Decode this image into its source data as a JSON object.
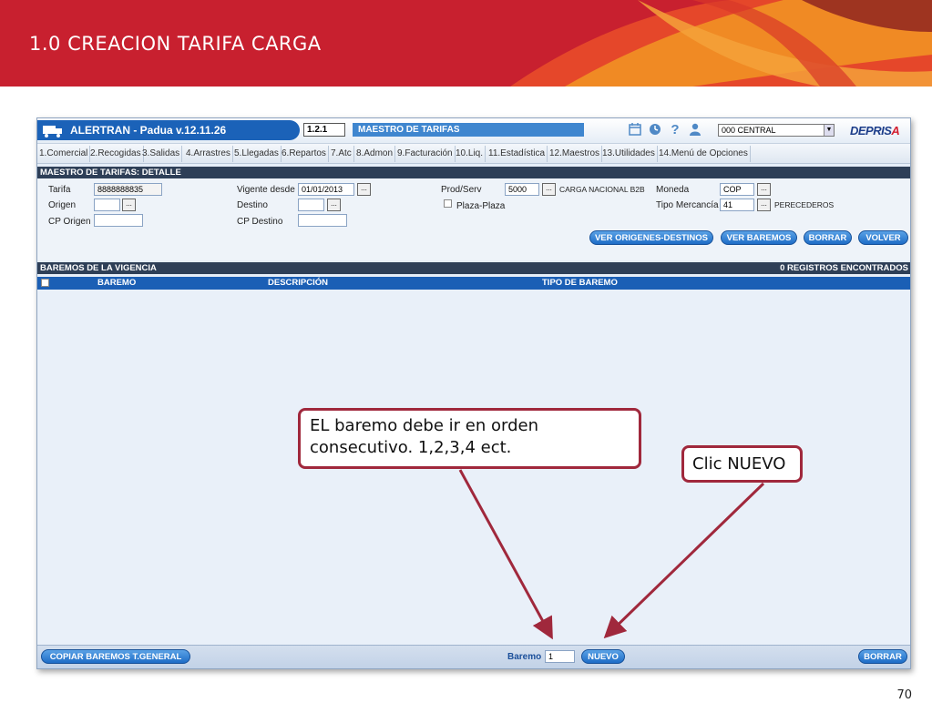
{
  "slide": {
    "title": "1.0 CREACION TARIFA CARGA",
    "page_number": "70"
  },
  "app": {
    "name": "ALERTRAN - Padua  v.12.11.26",
    "module_code": "1.2.1",
    "module_title": "MAESTRO DE TARIFAS",
    "branch": "000 CENTRAL",
    "logo_main": "DEPRIS",
    "logo_accent": "A",
    "top_icons": [
      "calendar-icon",
      "clock-icon",
      "help-icon",
      "user-icon"
    ]
  },
  "menu": [
    "1.Comercial",
    "2.Recogidas",
    "3.Salidas",
    "4.Arrastres",
    "5.Llegadas",
    "6.Repartos",
    "7.Atc",
    "8.Admon",
    "9.Facturación",
    "10.Liq.",
    "11.Estadística",
    "12.Maestros",
    "13.Utilidades",
    "14.Menú de Opciones"
  ],
  "detail": {
    "header": "MAESTRO DE TARIFAS: DETALLE",
    "tarifa_label": "Tarifa",
    "tarifa_value": "8888888835",
    "origen_label": "Origen",
    "origen_value": "",
    "cp_origen_label": "CP Origen",
    "cp_origen_value": "",
    "vigente_label": "Vigente desde",
    "vigente_value": "01/01/2013",
    "destino_label": "Destino",
    "destino_value": "",
    "cp_destino_label": "CP Destino",
    "cp_destino_value": "",
    "prodserv_label": "Prod/Serv",
    "prodserv_value": "5000",
    "prodserv_desc": "CARGA NACIONAL B2B",
    "plaza_label": "Plaza-Plaza",
    "moneda_label": "Moneda",
    "moneda_value": "COP",
    "tipo_merc_label": "Tipo Mercancía",
    "tipo_merc_value": "41",
    "tipo_merc_desc": "PERECEDEROS",
    "dots": "...",
    "buttons": {
      "ver_origenes": "VER ORIGENES-DESTINOS",
      "ver_baremos": "VER BAREMOS",
      "borrar": "BORRAR",
      "volver": "VOLVER"
    }
  },
  "baremos": {
    "header": "BAREMOS DE LA VIGENCIA",
    "count": "0 REGISTROS ENCONTRADOS",
    "columns": [
      "BAREMO",
      "DESCRIPCIÓN",
      "TIPO DE BAREMO"
    ],
    "rows": []
  },
  "bottom": {
    "copiar_label": "COPIAR BAREMOS T.GENERAL",
    "baremo_label": "Baremo",
    "baremo_value": "1",
    "nuevo_label": "NUEVO",
    "borrar_label": "BORRAR"
  },
  "callouts": {
    "orden": "EL baremo debe ir en orden consecutivo. 1,2,3,4 ect.",
    "nuevo": "Clic NUEVO"
  },
  "colors": {
    "banner_red": "#c8202f",
    "app_blue": "#1b62b8",
    "header_dark": "#2e3f57",
    "callout_border": "#a0283c"
  }
}
